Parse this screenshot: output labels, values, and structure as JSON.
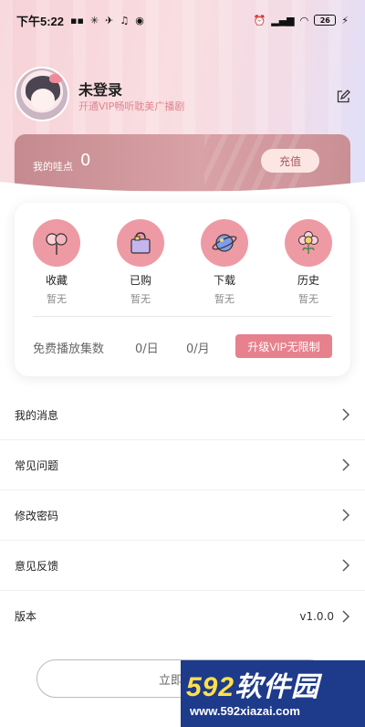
{
  "status_bar": {
    "time": "下午5:22",
    "battery": "26"
  },
  "profile": {
    "username": "未登录",
    "vip_tip": "开通VIP畅听耽美广播剧"
  },
  "wallet": {
    "label": "我的哇点",
    "value": "0",
    "recharge_label": "充值"
  },
  "quick_actions": [
    {
      "label": "收藏",
      "sub": "暂无",
      "icon": "lollipop-icon"
    },
    {
      "label": "已购",
      "sub": "暂无",
      "icon": "shopping-bag-icon"
    },
    {
      "label": "下载",
      "sub": "暂无",
      "icon": "planet-icon"
    },
    {
      "label": "历史",
      "sub": "暂无",
      "icon": "flower-icon"
    }
  ],
  "free_plays": {
    "label": "免费播放集数",
    "per_day": "0/日",
    "per_month": "0/月",
    "upgrade_label": "升级VIP无限制"
  },
  "menu": [
    {
      "label": "我的消息"
    },
    {
      "label": "常见问题"
    },
    {
      "label": "修改密码"
    },
    {
      "label": "意见反馈"
    },
    {
      "label": "版本",
      "value": "v1.0.0"
    }
  ],
  "login_button": "立即登录",
  "watermark": {
    "num": "592",
    "text": "软件园",
    "url": "www.592xiazai.com"
  },
  "colors": {
    "accent": "#ee9aa4",
    "upgrade": "#e6818d",
    "wallet": "#c58a8f"
  }
}
